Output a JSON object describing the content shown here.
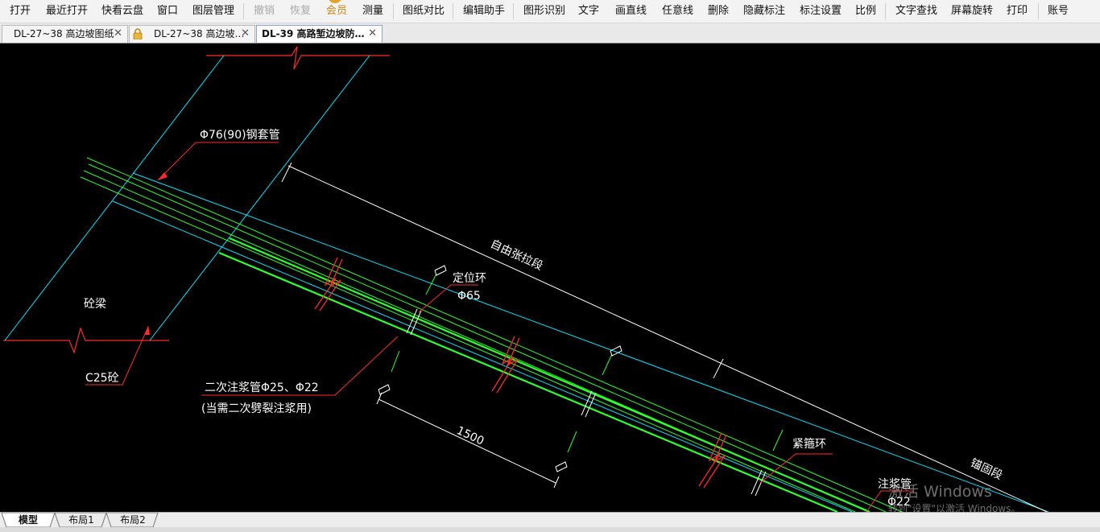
{
  "toolbar": {
    "open": "打开",
    "recent": "最近打开",
    "cloud": "快看云盘",
    "window": "窗口",
    "layers": "图层管理",
    "undo": "撤销",
    "redo": "恢复",
    "member": "会员",
    "measure": "测量",
    "compare": "图纸对比",
    "edit_helper": "编辑助手",
    "shape_recognize": "图形识别",
    "text": "文字",
    "line": "画直线",
    "free_line": "任意线",
    "delete": "删除",
    "hide_marks": "隐藏标注",
    "mark_settings": "标注设置",
    "scale": "比例",
    "text_search": "文字查找",
    "rotate": "屏幕旋转",
    "print": "打印",
    "account": "账号"
  },
  "tabs": [
    {
      "label": "DL-27~38 高边坡图纸",
      "locked": false,
      "active": false
    },
    {
      "label": "DL-27~38 高边坡…",
      "locked": true,
      "active": false
    },
    {
      "label": "DL-39 高路堑边坡防…",
      "locked": false,
      "active": true
    }
  ],
  "drawing": {
    "steel_pipe": "Φ76(90)钢套管",
    "free_segment": "自由张拉段",
    "positioning_ring": "定位环",
    "ring_dia": "Φ65",
    "beam": "砼梁",
    "concrete_grade": "C25砼",
    "secondary_pipe": "二次注浆管Φ25、Φ22",
    "secondary_note": "(当需二次劈裂注浆用)",
    "spacing": "1500",
    "tight_ring": "紧箍环",
    "anchor_segment": "锚固段",
    "grout_pipe": "注浆管",
    "grout_dia": "Φ22"
  },
  "layouts": [
    "模型",
    "布局1",
    "布局2"
  ],
  "watermark": {
    "title": "激活 Windows",
    "subtitle": "转到\"设置\"以激活 Windows。"
  },
  "colors": {
    "canvas": "#000000",
    "cyan": "#00ffff",
    "green": "#00ff00",
    "red": "#ff0000",
    "white": "#ffffff"
  }
}
